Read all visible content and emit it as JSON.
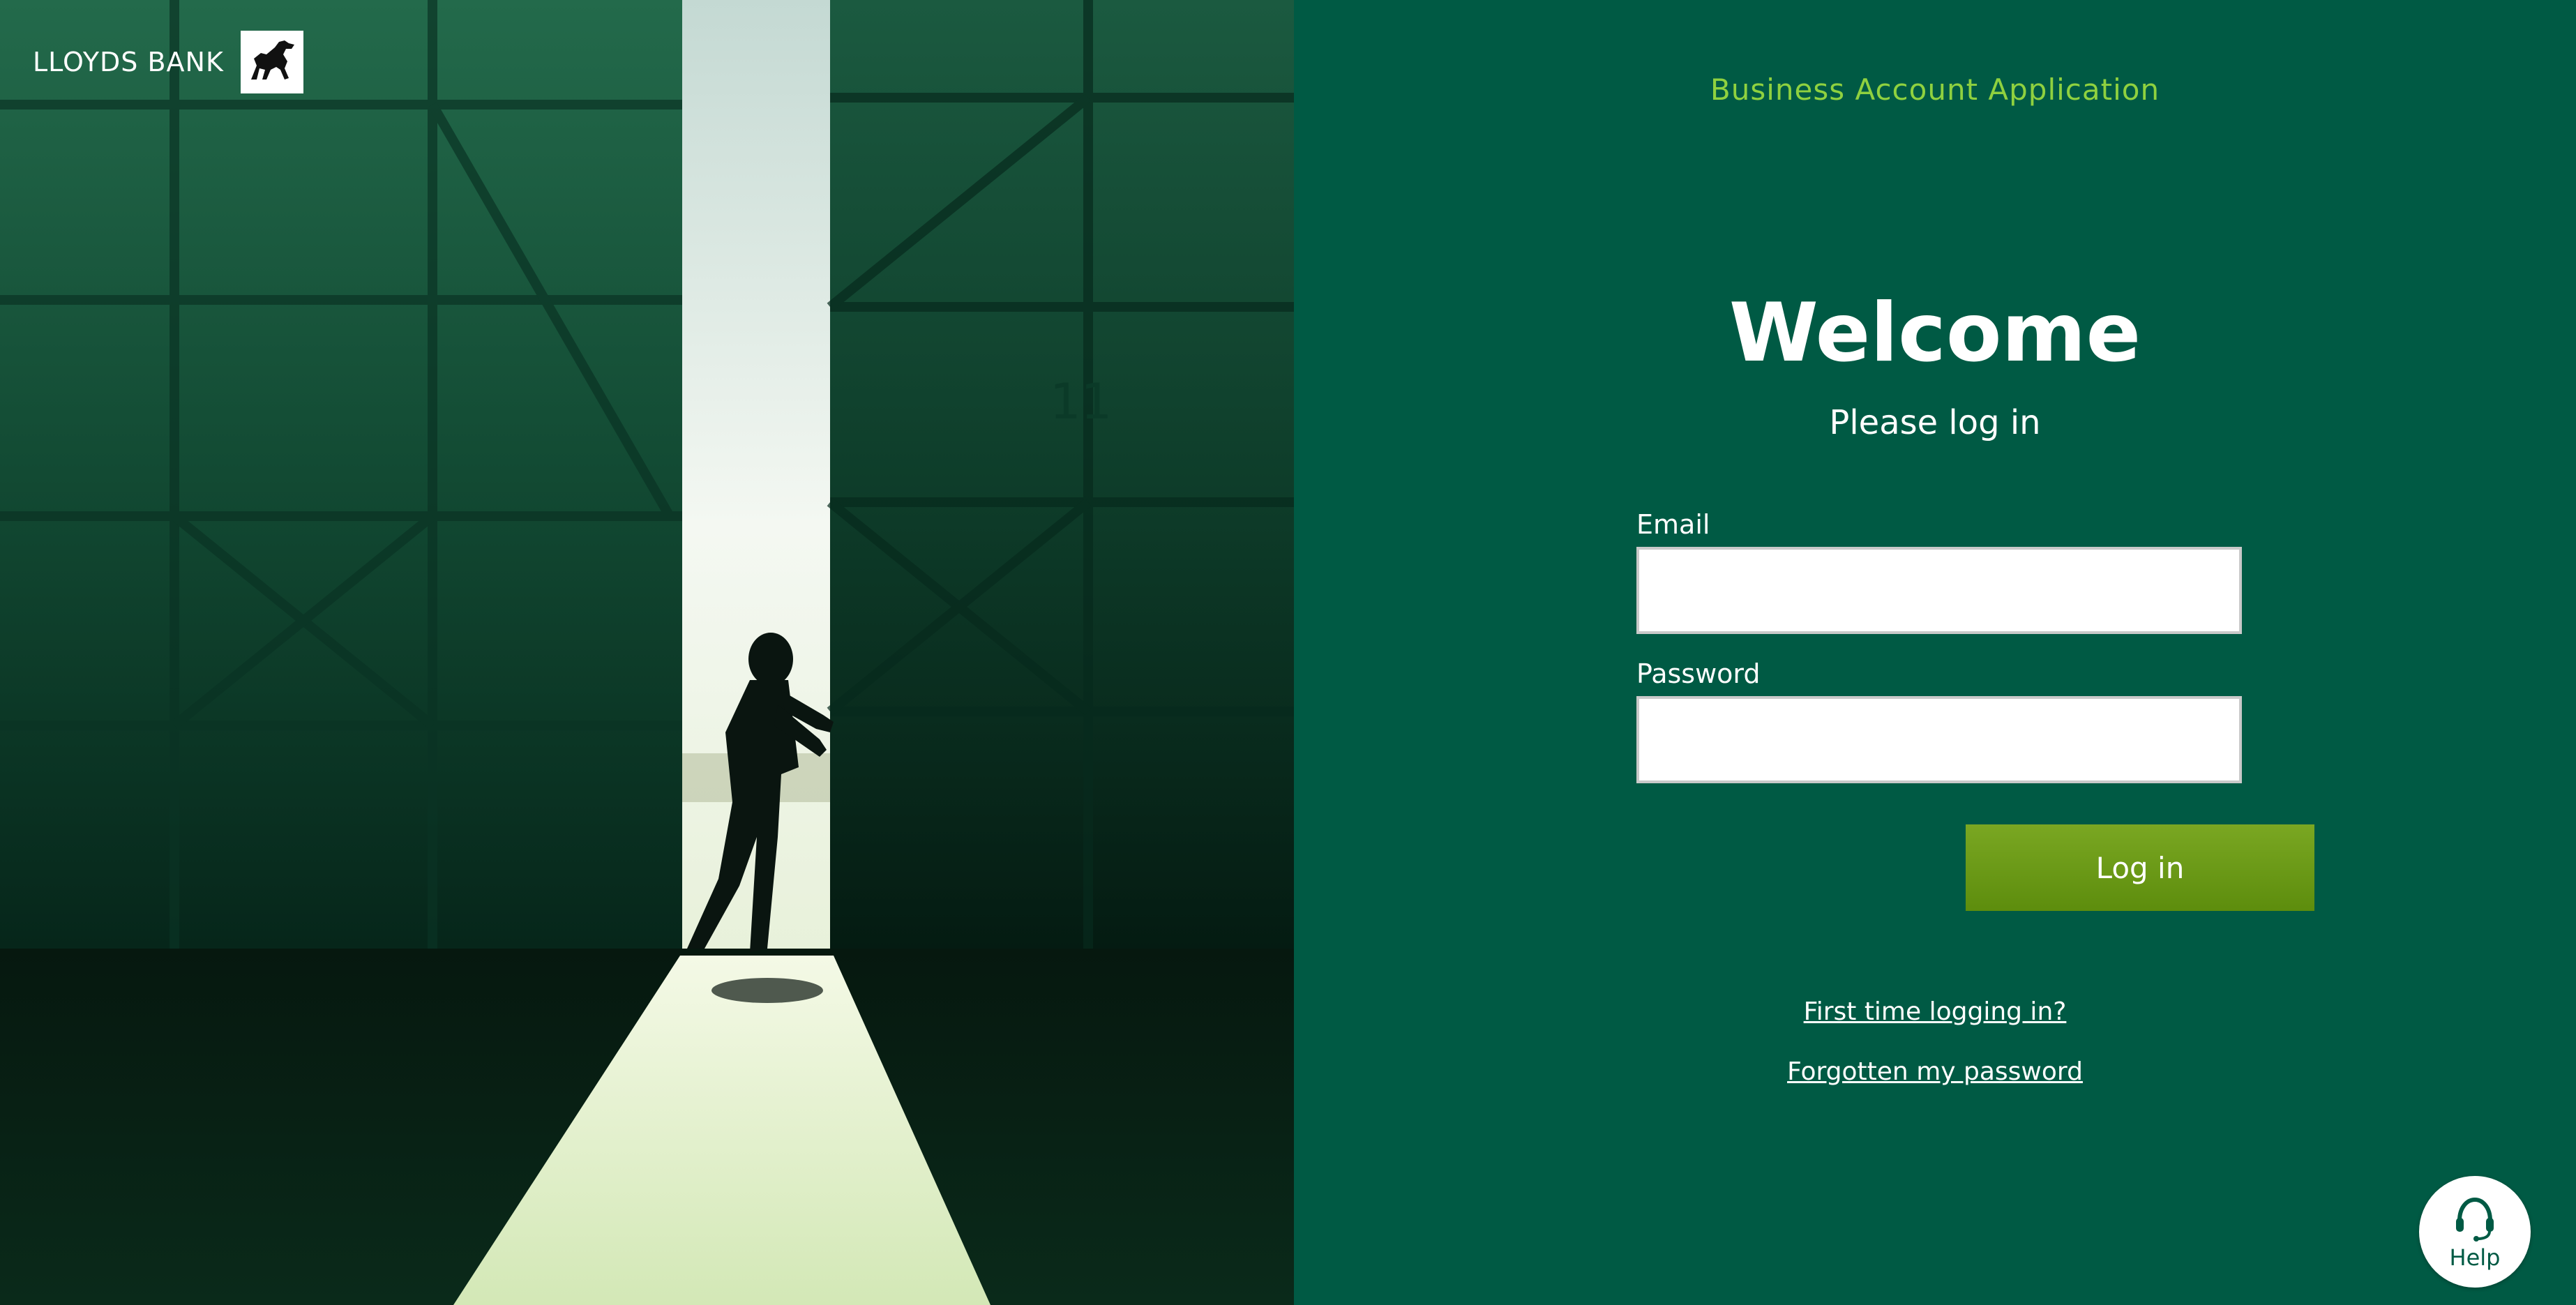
{
  "brand": {
    "name": "LLOYDS BANK",
    "logo_icon": "black-horse-icon"
  },
  "hero": {
    "image_icon": "man-opening-hangar-door-image",
    "door_number": "11"
  },
  "panel": {
    "app_title": "Business Account Application",
    "welcome": "Welcome",
    "subtitle": "Please log in"
  },
  "form": {
    "email_label": "Email",
    "email_value": "",
    "password_label": "Password",
    "password_value": "",
    "login_label": "Log in"
  },
  "links": {
    "first_time": "First time logging in?",
    "forgotten": "Forgotten my password"
  },
  "help": {
    "label": "Help",
    "icon": "headset-icon"
  },
  "colors": {
    "panel_background": "#005a44",
    "app_title": "#8fd13f",
    "button": "#6a9a18",
    "text": "#ffffff"
  }
}
